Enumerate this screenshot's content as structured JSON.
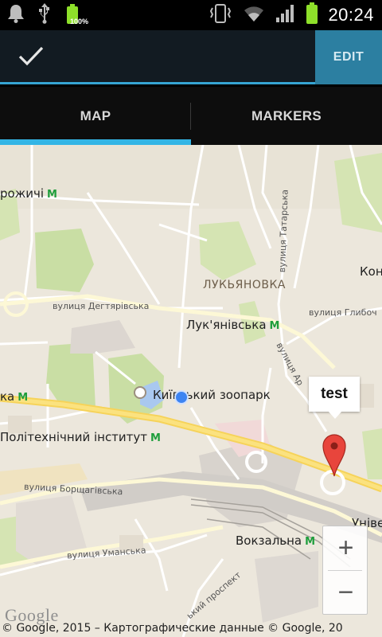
{
  "status_bar": {
    "battery_small_label": "100%",
    "time": "20:24",
    "icons": [
      "notification-bell-icon",
      "usb-icon",
      "battery-icon",
      "vibrate-icon",
      "wifi-icon",
      "signal-icon",
      "battery-icon"
    ]
  },
  "action_bar": {
    "done_icon": "checkmark-icon",
    "edit_label": "EDIT",
    "accent_color": "#33b5e5"
  },
  "tabs": [
    {
      "label": "MAP",
      "selected": true
    },
    {
      "label": "MARKERS",
      "selected": false
    }
  ],
  "map": {
    "labels": {
      "district": "ЛУКЬЯНОВКА",
      "partial_left_top": "рожичі",
      "street_degtyarivska": "вулиця Дегтярівська",
      "station_lukyanivska": "Лук'янівська",
      "zoo": "Київський зоопарк",
      "station_polytechnic": "Політехнічний інститут",
      "street_borshchahivska": "вулиця Борщагівська",
      "street_umanska": "вулиця Уманська",
      "station_vokzalna": "Вокзальна",
      "street_tatarska": "вулиця Татарська",
      "street_hlybochytska": "вулиця Глибоч",
      "street_art": "вулиця Ар",
      "partial_kon": "Кон",
      "partial_universytet": "Універси",
      "prospekt": "ький проспект",
      "partial_ka": "ка"
    },
    "marker_title": "test",
    "zoom_in_label": "+",
    "zoom_out_label": "−",
    "google_logo": "Google",
    "copyright": "© Google, 2015 – Картографические данные © Google, 20"
  }
}
